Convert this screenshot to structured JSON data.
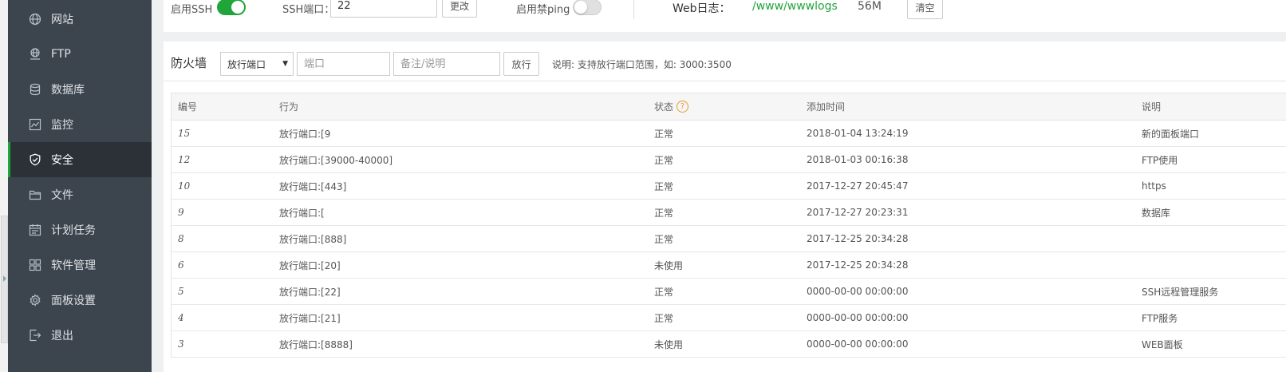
{
  "sidebar": {
    "items": [
      {
        "label": "网站",
        "icon": "globe-icon"
      },
      {
        "label": "FTP",
        "icon": "ftp-icon"
      },
      {
        "label": "数据库",
        "icon": "database-icon"
      },
      {
        "label": "监控",
        "icon": "monitor-icon"
      },
      {
        "label": "安全",
        "icon": "shield-icon",
        "active": true
      },
      {
        "label": "文件",
        "icon": "folder-icon"
      },
      {
        "label": "计划任务",
        "icon": "calendar-icon"
      },
      {
        "label": "软件管理",
        "icon": "apps-icon"
      },
      {
        "label": "面板设置",
        "icon": "gear-icon"
      },
      {
        "label": "退出",
        "icon": "logout-icon"
      }
    ]
  },
  "top": {
    "ssh_label": "启用SSH",
    "ssh_enabled": true,
    "ssh_port_label": "SSH端口：",
    "ssh_port_value": "22",
    "change_button": "更改",
    "ping_label": "启用禁ping",
    "ping_enabled": false,
    "weblog_label": "Web日志：",
    "weblog_path": "/www/wwwlogs",
    "weblog_size": "56M",
    "clear_button": "清空"
  },
  "firewall": {
    "title": "防火墙",
    "select_value": "放行端口",
    "port_placeholder": "端口",
    "note_placeholder": "备注/说明",
    "allow_button": "放行",
    "help_text": "说明: 支持放行端口范围，如: 3000:3500",
    "columns": {
      "id": "编号",
      "action": "行为",
      "status": "状态",
      "time": "添加时间",
      "note": "说明"
    },
    "rows": [
      {
        "id": "15",
        "action": "放行端口:[9",
        "status": "正常",
        "time": "2018-01-04 13:24:19",
        "note": "新的面板端口"
      },
      {
        "id": "12",
        "action": "放行端口:[39000-40000]",
        "status": "正常",
        "time": "2018-01-03 00:16:38",
        "note": "FTP使用"
      },
      {
        "id": "10",
        "action": "放行端口:[443]",
        "status": "正常",
        "time": "2017-12-27 20:45:47",
        "note": "https"
      },
      {
        "id": "9",
        "action": "放行端口:[",
        "status": "正常",
        "time": "2017-12-27 20:23:31",
        "note": "数据库"
      },
      {
        "id": "8",
        "action": "放行端口:[888]",
        "status": "正常",
        "time": "2017-12-25 20:34:28",
        "note": ""
      },
      {
        "id": "6",
        "action": "放行端口:[20]",
        "status": "未使用",
        "time": "2017-12-25 20:34:28",
        "note": ""
      },
      {
        "id": "5",
        "action": "放行端口:[22]",
        "status": "正常",
        "time": "0000-00-00 00:00:00",
        "note": "SSH远程管理服务"
      },
      {
        "id": "4",
        "action": "放行端口:[21]",
        "status": "正常",
        "time": "0000-00-00 00:00:00",
        "note": "FTP服务"
      },
      {
        "id": "3",
        "action": "放行端口:[8888]",
        "status": "未使用",
        "time": "0000-00-00 00:00:00",
        "note": "WEB面板"
      }
    ]
  },
  "colors": {
    "sidebar_bg": "#3c444d",
    "sidebar_active_bg": "#2b3137",
    "accent_green": "#20a53a",
    "help_orange": "#e69a2b"
  }
}
